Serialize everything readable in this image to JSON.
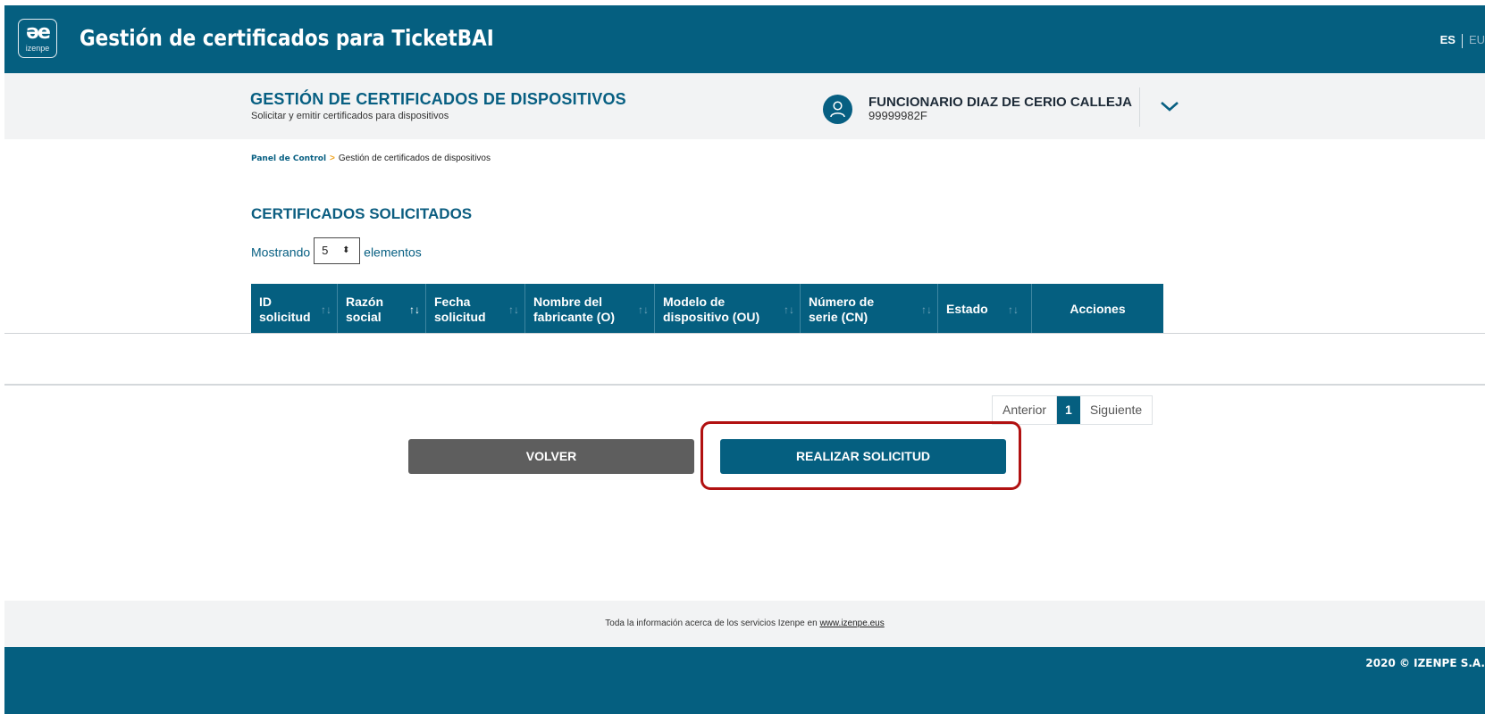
{
  "header": {
    "logo_mark": "əe",
    "logo_word": "izenpe",
    "title": "Gestión de certificados para TicketBAI",
    "lang_active": "ES",
    "lang_other": "EU"
  },
  "subheader": {
    "title": "GESTIÓN DE CERTIFICADOS DE DISPOSITIVOS",
    "subtitle": "Solicitar y emitir certificados para dispositivos",
    "user_name": "FUNCIONARIO DIAZ DE CERIO CALLEJA",
    "user_id": "99999982F"
  },
  "breadcrumb": {
    "home": "Panel de Control",
    "separator": ">",
    "current": "Gestión de certificados de dispositivos"
  },
  "section": {
    "title": "CERTIFICADOS SOLICITADOS",
    "showing_prefix": "Mostrando",
    "page_size": "5",
    "showing_suffix": "elementos"
  },
  "table": {
    "columns": [
      {
        "line1": "ID",
        "line2": "solicitud"
      },
      {
        "line1": "Razón",
        "line2": "social"
      },
      {
        "line1": "Fecha",
        "line2": "solicitud"
      },
      {
        "line1": "Nombre del",
        "line2": "fabricante (O)"
      },
      {
        "line1": "Modelo de",
        "line2": "dispositivo (OU)"
      },
      {
        "line1": "Número de",
        "line2": "serie (CN)"
      },
      {
        "line1": "Estado",
        "line2": ""
      },
      {
        "line1": "Acciones",
        "line2": ""
      }
    ],
    "sort_glyph": "↑↓"
  },
  "pagination": {
    "previous": "Anterior",
    "current": "1",
    "next": "Siguiente"
  },
  "actions": {
    "back": "VOLVER",
    "submit": "REALIZAR SOLICITUD"
  },
  "footer": {
    "info_text": "Toda la información acerca de los servicios Izenpe en",
    "info_link": "www.izenpe.eus",
    "copyright": "2020 © IZENPE S.A."
  },
  "colors": {
    "brand": "#055f80",
    "back_button": "#5e5e5e",
    "highlight": "#b11111",
    "breadcrumb_separator": "#f0a31f"
  }
}
